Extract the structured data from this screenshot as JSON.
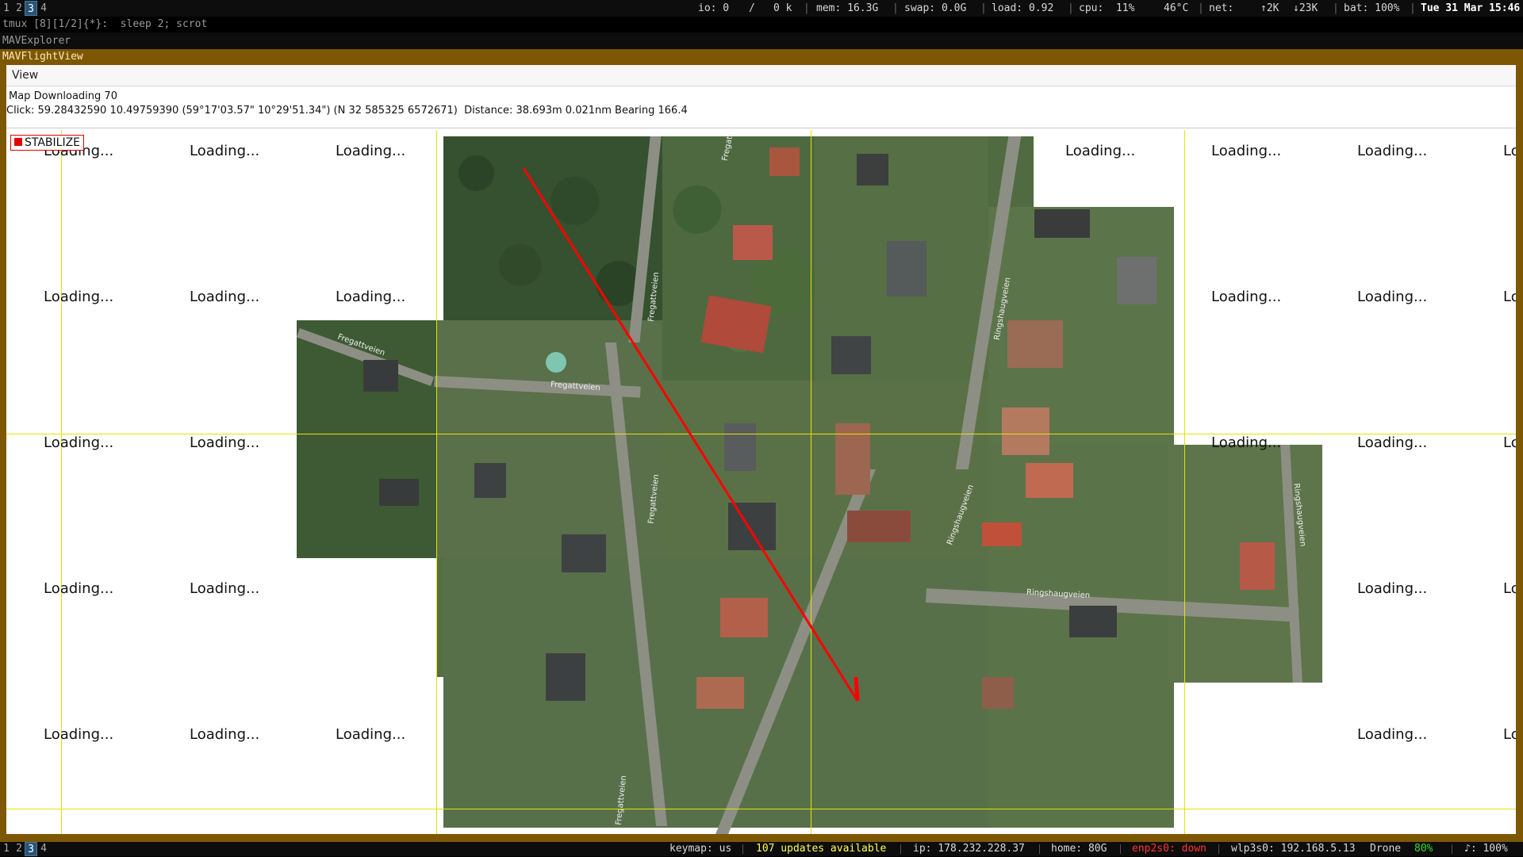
{
  "topbar": {
    "workspaces": [
      "1",
      "2",
      "3",
      "4"
    ],
    "active_workspace": "3",
    "io": "io: 0",
    "io_slash": "/",
    "io_k": "0 k",
    "mem": "mem: 16.3G",
    "swap": "swap: 0.0G",
    "load": "load: 0.92",
    "cpu": "cpu:  11%",
    "temp": "46°C",
    "net_label": "net:",
    "net_up": "↑2K",
    "net_down": "↓23K",
    "bat": "bat: 100%",
    "date": "Tue 31 Mar 15:46"
  },
  "tmux": {
    "line": "tmux [8][1/2]{*}:  sleep 2; scrot"
  },
  "explorer": {
    "title": "MAVExplorer"
  },
  "window": {
    "title": "MAVFlightView",
    "menu_view": "View",
    "status": "Map Downloading 70",
    "click_info": "Click: 59.28432590 10.49759390 (59°17'03.57\" 10°29'51.34\") (N 32 585325 6572671)  Distance: 38.693m 0.021nm Bearing 166.4"
  },
  "map": {
    "mode_label": "STABILIZE",
    "loading_text": "Loading...",
    "road_labels": [
      "Fregattveien",
      "Fregattveien",
      "Fregattveien",
      "Fregattveien",
      "Fregattveien",
      "Ringshaugveien",
      "Ringshaugveien",
      "Ringshaugveien",
      "Ringshaugveien",
      "Fregatt"
    ],
    "track_color": "#ff0000",
    "grid_color": "#e4e400"
  },
  "botbar": {
    "workspaces": [
      "1",
      "2",
      "3",
      "4"
    ],
    "active_workspace": "3",
    "keymap": "keymap: us",
    "updates": "107 updates available",
    "ip": "ip: 178.232.228.37",
    "home": "home: 80G",
    "enp": "enp2s0: down",
    "wlp": "wlp3s0: 192.168.5.13",
    "drone": "Drone",
    "drone_pct": "80%",
    "volume": "♪: 100%"
  },
  "colors": {
    "frame": "#7d5704",
    "workspace_active": "#285577",
    "updates": "#ffff55",
    "down": "#ff3333",
    "ok": "#33dd33"
  }
}
